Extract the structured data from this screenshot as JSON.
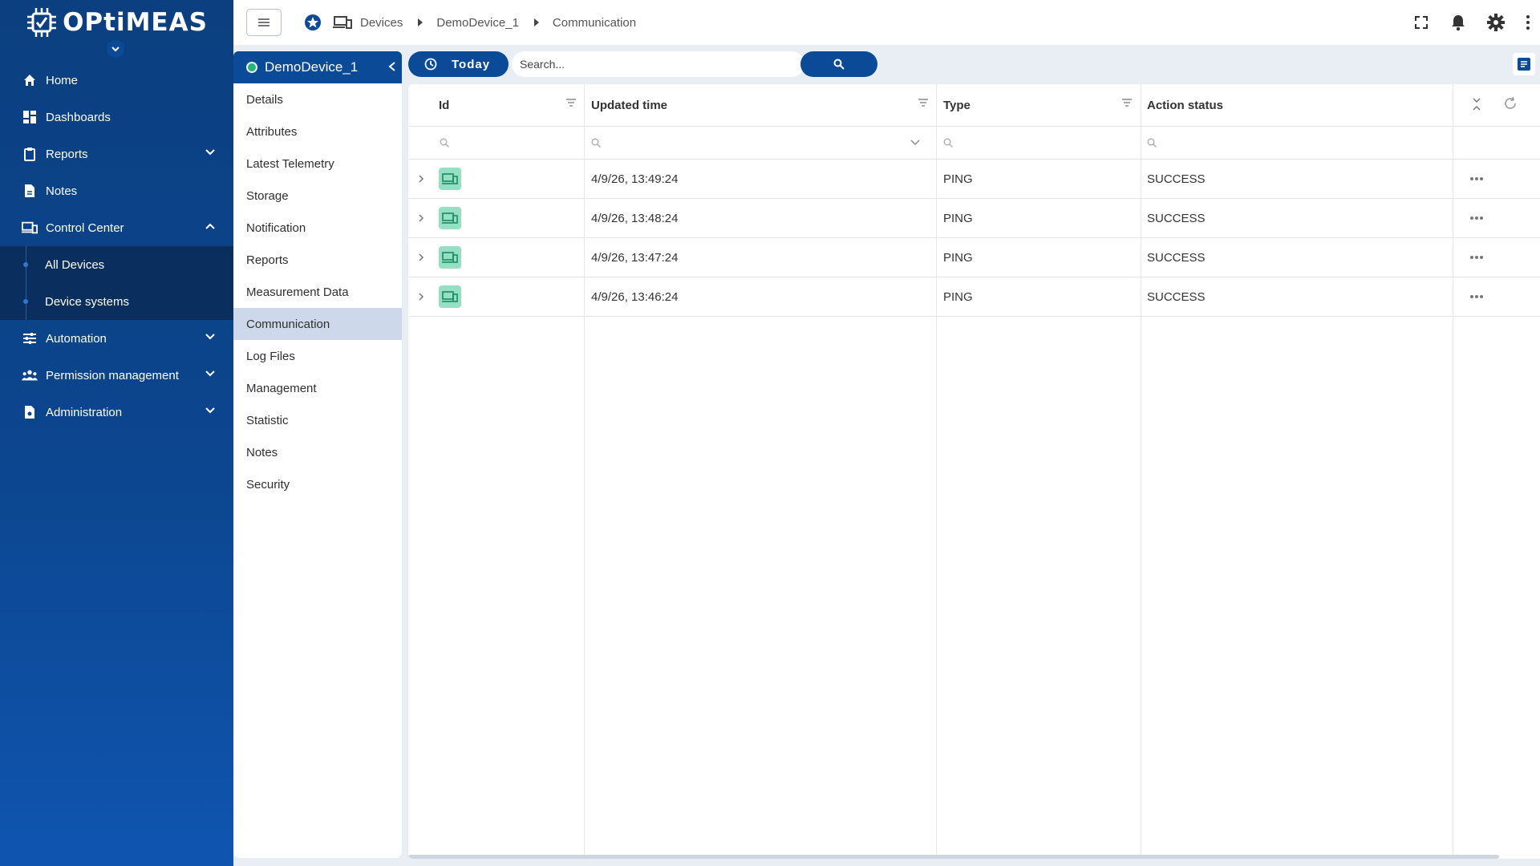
{
  "brand": {
    "logo_text": "OPtiMEAS"
  },
  "sidebar": {
    "items": [
      {
        "label": "Home",
        "icon": "home-icon"
      },
      {
        "label": "Dashboards",
        "icon": "dashboard-icon"
      },
      {
        "label": "Reports",
        "icon": "clipboard-icon",
        "expanded": false
      },
      {
        "label": "Notes",
        "icon": "note-icon"
      },
      {
        "label": "Control Center",
        "icon": "devices-icon",
        "expanded": true
      },
      {
        "label": "Automation",
        "icon": "sliders-icon",
        "expanded": false
      },
      {
        "label": "Permission management",
        "icon": "people-icon",
        "expanded": false
      },
      {
        "label": "Administration",
        "icon": "admin-doc-icon",
        "expanded": false
      }
    ],
    "control_center_children": [
      {
        "label": "All Devices"
      },
      {
        "label": "Device systems"
      }
    ]
  },
  "breadcrumb": {
    "items": [
      "Devices",
      "DemoDevice_1",
      "Communication"
    ]
  },
  "device_panel": {
    "title": "DemoDevice_1",
    "status_color": "#29b07f",
    "items": [
      "Details",
      "Attributes",
      "Latest Telemetry",
      "Storage",
      "Notification",
      "Reports",
      "Measurement Data",
      "Communication",
      "Log Files",
      "Management",
      "Statistic",
      "Notes",
      "Security"
    ],
    "active": "Communication"
  },
  "toolbar": {
    "today_label": "Today",
    "search_placeholder": "Search...",
    "search_value": ""
  },
  "table": {
    "columns": [
      "Id",
      "Updated time",
      "Type",
      "Action status"
    ],
    "rows": [
      {
        "updated": "4/9/26, 13:49:24",
        "type": "PING",
        "status": "SUCCESS"
      },
      {
        "updated": "4/9/26, 13:48:24",
        "type": "PING",
        "status": "SUCCESS"
      },
      {
        "updated": "4/9/26, 13:47:24",
        "type": "PING",
        "status": "SUCCESS"
      },
      {
        "updated": "4/9/26, 13:46:24",
        "type": "PING",
        "status": "SUCCESS"
      }
    ]
  },
  "colors": {
    "primary": "#0b4a96",
    "sidebar_bg": "#0c468f",
    "active_item_bg": "#cdd9ea",
    "device_badge": "#95dfc3",
    "status_online": "#29b07f"
  }
}
